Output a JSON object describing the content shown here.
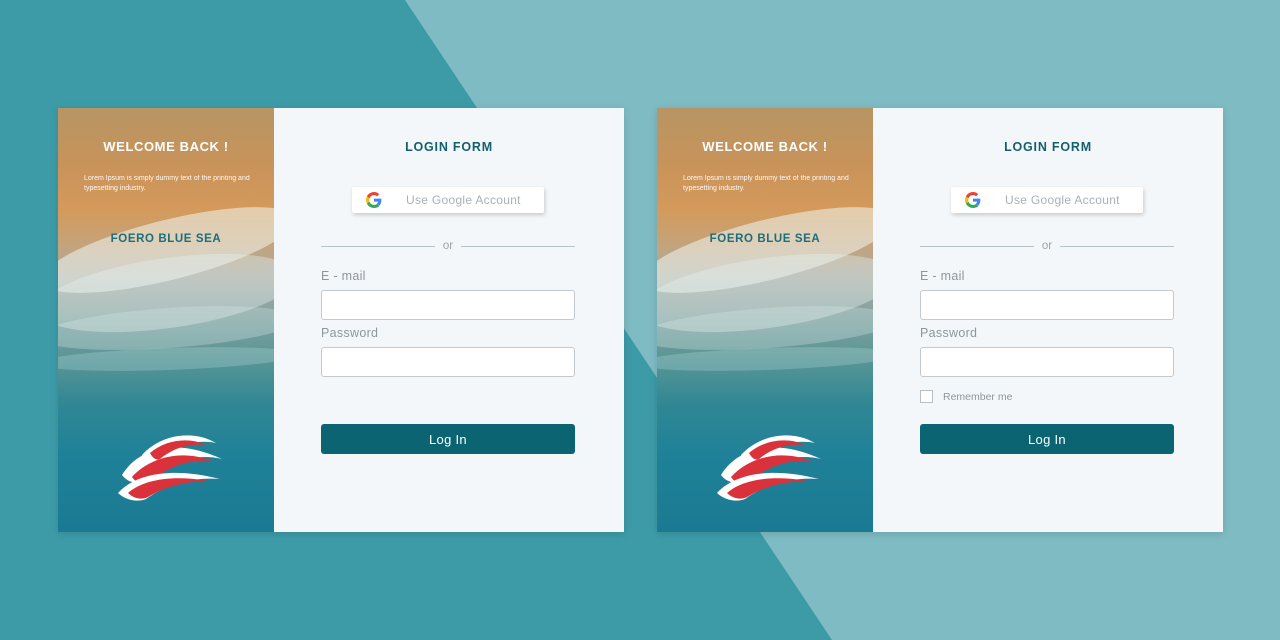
{
  "colors": {
    "background_dark": "#3d9ba8",
    "background_light": "#7fbbc3",
    "form_title": "#155f6d",
    "brand": "#1d6d7a",
    "login_button": "#0b6472",
    "logo_red": "#d9323a"
  },
  "cards": [
    {
      "hero": {
        "title": "WELCOME BACK !",
        "text": "Lorem Ipsum is simply dummy text of the printing and typesetting industry.",
        "brand": "FOERO BLUE SEA"
      },
      "form": {
        "title": "LOGIN FORM",
        "google_label": "Use Google Account",
        "or": "or",
        "email_label": "E - mail",
        "email_value": "",
        "password_label": "Password",
        "password_value": "",
        "login_label": "Log In"
      }
    },
    {
      "hero": {
        "title": "WELCOME BACK !",
        "text": "Lorem Ipsum is simply dummy text of the printing and typesetting industry.",
        "brand": "FOERO BLUE SEA"
      },
      "form": {
        "title": "LOGIN FORM",
        "google_label": "Use Google Account",
        "or": "or",
        "email_label": "E - mail",
        "email_value": "",
        "password_label": "Password",
        "password_value": "",
        "remember_label": "Remember me",
        "remember_checked": false,
        "login_label": "Log In"
      }
    }
  ]
}
